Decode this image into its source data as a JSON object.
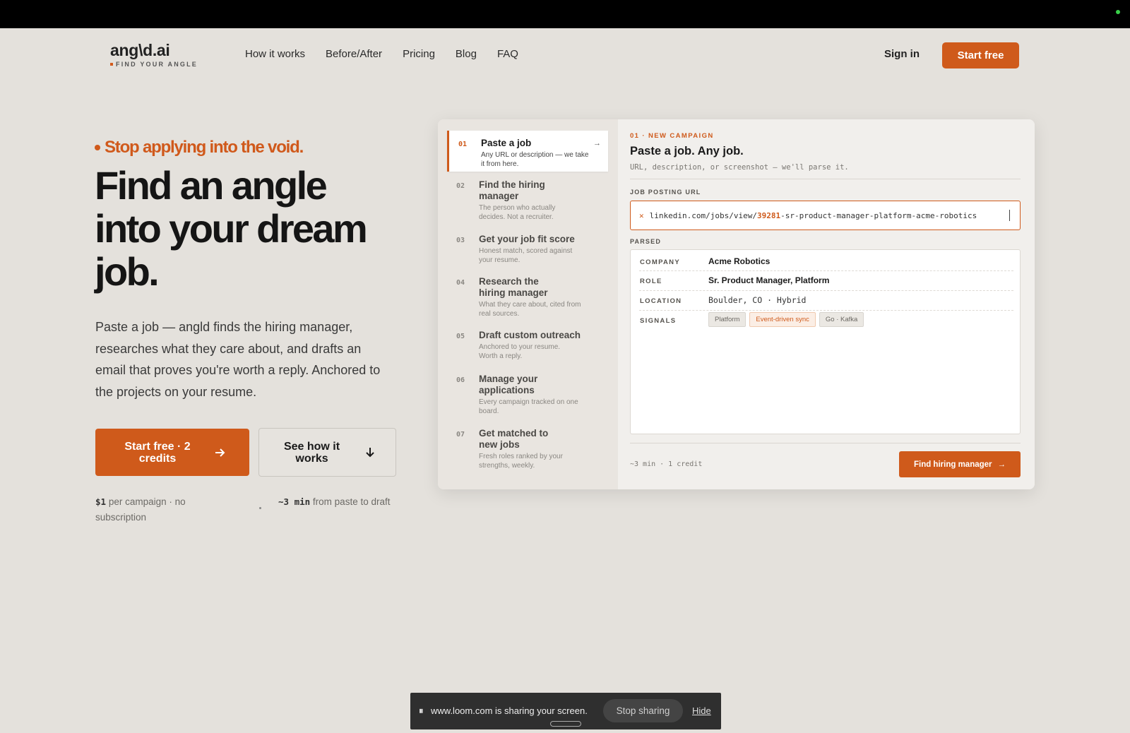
{
  "colors": {
    "accent": "#cf5a1b",
    "background": "#e4e1dc",
    "topbar": "#000000"
  },
  "nav": {
    "logo": "ang\\d.ai",
    "tagline": "FIND YOUR ANGLE",
    "links": [
      "How it works",
      "Before/After",
      "Pricing",
      "Blog",
      "FAQ"
    ],
    "signin": "Sign in",
    "start_free": "Start free"
  },
  "hero": {
    "eyebrow": "Stop applying into the void.",
    "headline": "Find an angle into your dream job.",
    "lead": "Paste a job — angld finds the hiring manager, researches what they care about, and drafts an email that proves you're worth a reply. Anchored to the projects on your resume.",
    "cta_primary": "Start free · 2 credits",
    "cta_primary_icon": "arrow-right-icon",
    "cta_secondary": "See how it works",
    "cta_secondary_icon": "arrow-down-icon",
    "meta1_value": "$1",
    "meta1_text": "per campaign · no subscription",
    "meta2_value": "~3 min",
    "meta2_text": "from paste to draft"
  },
  "steps": [
    {
      "num": "01",
      "title": "Paste a job",
      "desc": "Any URL or description — we take it from here.",
      "active": true
    },
    {
      "num": "02",
      "title": "Find the hiring manager",
      "desc": "The person who actually decides. Not a recruiter."
    },
    {
      "num": "03",
      "title": "Get your job fit score",
      "desc": "Honest match, scored against your resume."
    },
    {
      "num": "04",
      "title": "Research the hiring manager",
      "desc": "What they care about, cited from real sources."
    },
    {
      "num": "05",
      "title": "Draft custom outreach",
      "desc": "Anchored to your resume. Worth a reply."
    },
    {
      "num": "06",
      "title": "Manage your applications",
      "desc": "Every campaign tracked on one board."
    },
    {
      "num": "07",
      "title": "Get matched to new jobs",
      "desc": "Fresh roles ranked by your strengths, weekly."
    }
  ],
  "panel": {
    "eyebrow": "01 · NEW CAMPAIGN",
    "title": "Paste a job. Any job.",
    "subtitle": "URL, description, or screenshot — we'll parse it.",
    "url_label": "JOB POSTING URL",
    "url_prefix": "linkedin.com/jobs/view/",
    "url_id": "39281",
    "url_suffix": "-sr-product-manager-platform-acme-robotics",
    "parsed_label": "PARSED",
    "fields": {
      "company_label": "COMPANY",
      "company": "Acme Robotics",
      "role_label": "ROLE",
      "role": "Sr. Product Manager, Platform",
      "location_label": "LOCATION",
      "location": "Boulder, CO · Hybrid",
      "signals_label": "SIGNALS",
      "signals": [
        "Platform",
        "Event-driven sync",
        "Go · Kafka"
      ]
    },
    "footer": "~3 min · 1 credit",
    "button": "Find hiring manager"
  },
  "loom": {
    "message": "www.loom.com is sharing your screen.",
    "stop": "Stop sharing",
    "hide": "Hide"
  }
}
